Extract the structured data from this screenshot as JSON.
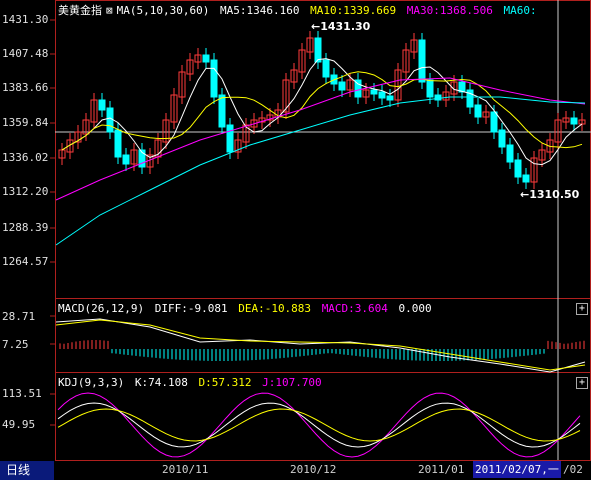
{
  "main_panel": {
    "title": "美黄金指",
    "ma_label": "MA(5,10,30,60)",
    "ma5": "MA5:1346.160",
    "ma10": "MA10:1339.669",
    "ma30": "MA30:1368.506",
    "ma60": "MA60:",
    "y_ticks": [
      "1431.30",
      "1407.48",
      "1383.66",
      "1359.84",
      "1336.02",
      "1312.20",
      "1288.39",
      "1264.57"
    ],
    "high_annot": "1431.30",
    "low_annot": "1310.50",
    "colors": {
      "ma5": "#ffffff",
      "ma10": "#ffff00",
      "ma30": "#ff00ff",
      "ma60": "#00ffff",
      "up": "#ff3b3b",
      "down": "#00ffff"
    }
  },
  "macd_panel": {
    "label": "MACD(26,12,9)",
    "diff": "DIFF:-9.081",
    "dea": "DEA:-10.883",
    "macd": "MACD:3.604",
    "zero": "0.000",
    "y_ticks": [
      "28.71",
      "7.25"
    ],
    "plus_label": "+"
  },
  "kdj_panel": {
    "label": "KDJ(9,3,3)",
    "k": "K:74.108",
    "d": "D:57.312",
    "j": "J:107.700",
    "y_ticks": [
      "113.51",
      "49.95"
    ],
    "plus_label": "+"
  },
  "x_axis": {
    "period_tab": "日线",
    "labels": [
      "2010/11",
      "2010/12",
      "2011/01"
    ],
    "cursor_date": "2011/02/07,一",
    "cursor_tail": "/02"
  }
}
